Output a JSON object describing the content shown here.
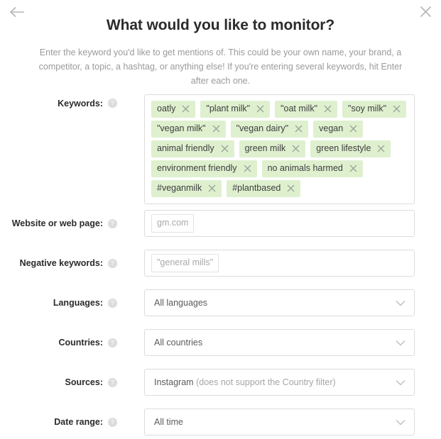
{
  "header": {
    "back_icon": "arrow-left-icon",
    "close_icon": "close-icon",
    "title": "What would you like to monitor?",
    "subtitle": "Enter the keyword you'd like to get mentions of. This could be your own name, your brand, a competitor, a topic, a hashtag, or anything else! If you're entering several keywords, hit Enter after each one."
  },
  "colors": {
    "tag_background": "#dff0cf",
    "tag_text": "#3d3d3d",
    "border": "#dcdcdc",
    "muted_text": "#9a9a9a",
    "title_text": "#2b2b2b"
  },
  "form": {
    "help_glyph": "?",
    "keywords": {
      "label": "Keywords:",
      "rows": [
        [
          "oatly",
          "\"plant milk\"",
          "\"oat milk\"",
          "\"soy milk\""
        ],
        [
          "\"vegan milk\"",
          "\"vegan dairy\"",
          "vegan"
        ],
        [
          "animal friendly",
          "green milk",
          "green lifestyle"
        ],
        [
          "environment friendly",
          "no animals harmed"
        ],
        [
          "#veganmilk",
          "#plantbased"
        ]
      ]
    },
    "website": {
      "label": "Website or web page:",
      "chip": "gm.com"
    },
    "negative_keywords": {
      "label": "Negative keywords:",
      "chip": "\"general mills\""
    },
    "languages": {
      "label": "Languages:",
      "value": "All languages"
    },
    "countries": {
      "label": "Countries:",
      "value": "All countries"
    },
    "sources": {
      "label": "Sources:",
      "value": "Instagram",
      "note": "(does not support the Country filter)"
    },
    "date_range": {
      "label": "Date range:",
      "value": "All time"
    }
  }
}
